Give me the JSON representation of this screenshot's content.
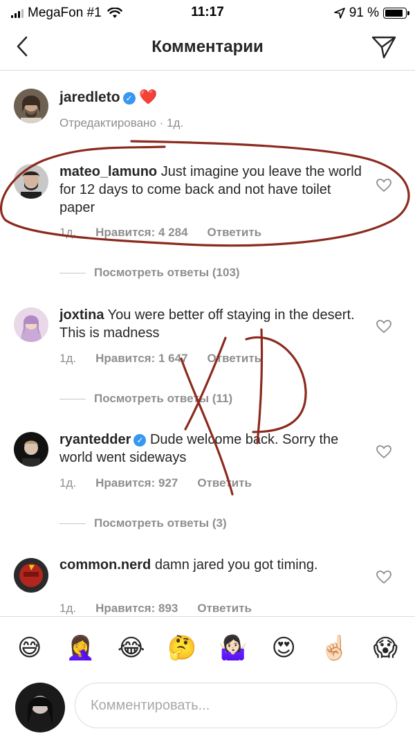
{
  "status_bar": {
    "carrier": "MegaFon #1",
    "time": "11:17",
    "battery": "91 %",
    "battery_level": 0.91
  },
  "header": {
    "title": "Комментарии"
  },
  "caption": {
    "username": "jaredleto",
    "verified": true,
    "text": "❤️",
    "meta": "Отредактировано · 1д."
  },
  "comments": [
    {
      "username": "mateo_lamuno",
      "verified": false,
      "text": "Just imagine you leave the world for 12 days to come back and not have toilet paper",
      "time": "1д.",
      "likes": "Нравится: 4 284",
      "reply": "Ответить",
      "view_replies": "Посмотреть ответы (103)"
    },
    {
      "username": "joxtina",
      "verified": false,
      "text": "You were better off staying in the desert. This is madness",
      "time": "1д.",
      "likes": "Нравится: 1 647",
      "reply": "Ответить",
      "view_replies": "Посмотреть ответы (11)"
    },
    {
      "username": "ryantedder",
      "verified": true,
      "text": "Dude welcome back. Sorry the world went sideways",
      "time": "1д.",
      "likes": "Нравится: 927",
      "reply": "Ответить",
      "view_replies": "Посмотреть ответы (3)"
    },
    {
      "username": "common.nerd",
      "verified": false,
      "text": "damn jared you got timing.",
      "time": "1д.",
      "likes": "Нравится: 893",
      "reply": "Ответить"
    }
  ],
  "emoji_bar": [
    "😅",
    "🤦‍♀️",
    "😂",
    "🤔",
    "🤷🏻‍♀️",
    "😍",
    "☝🏻",
    "😱"
  ],
  "input": {
    "placeholder": "Комментировать..."
  },
  "annotation": {
    "text": "XD",
    "color": "#8b2a1e"
  }
}
